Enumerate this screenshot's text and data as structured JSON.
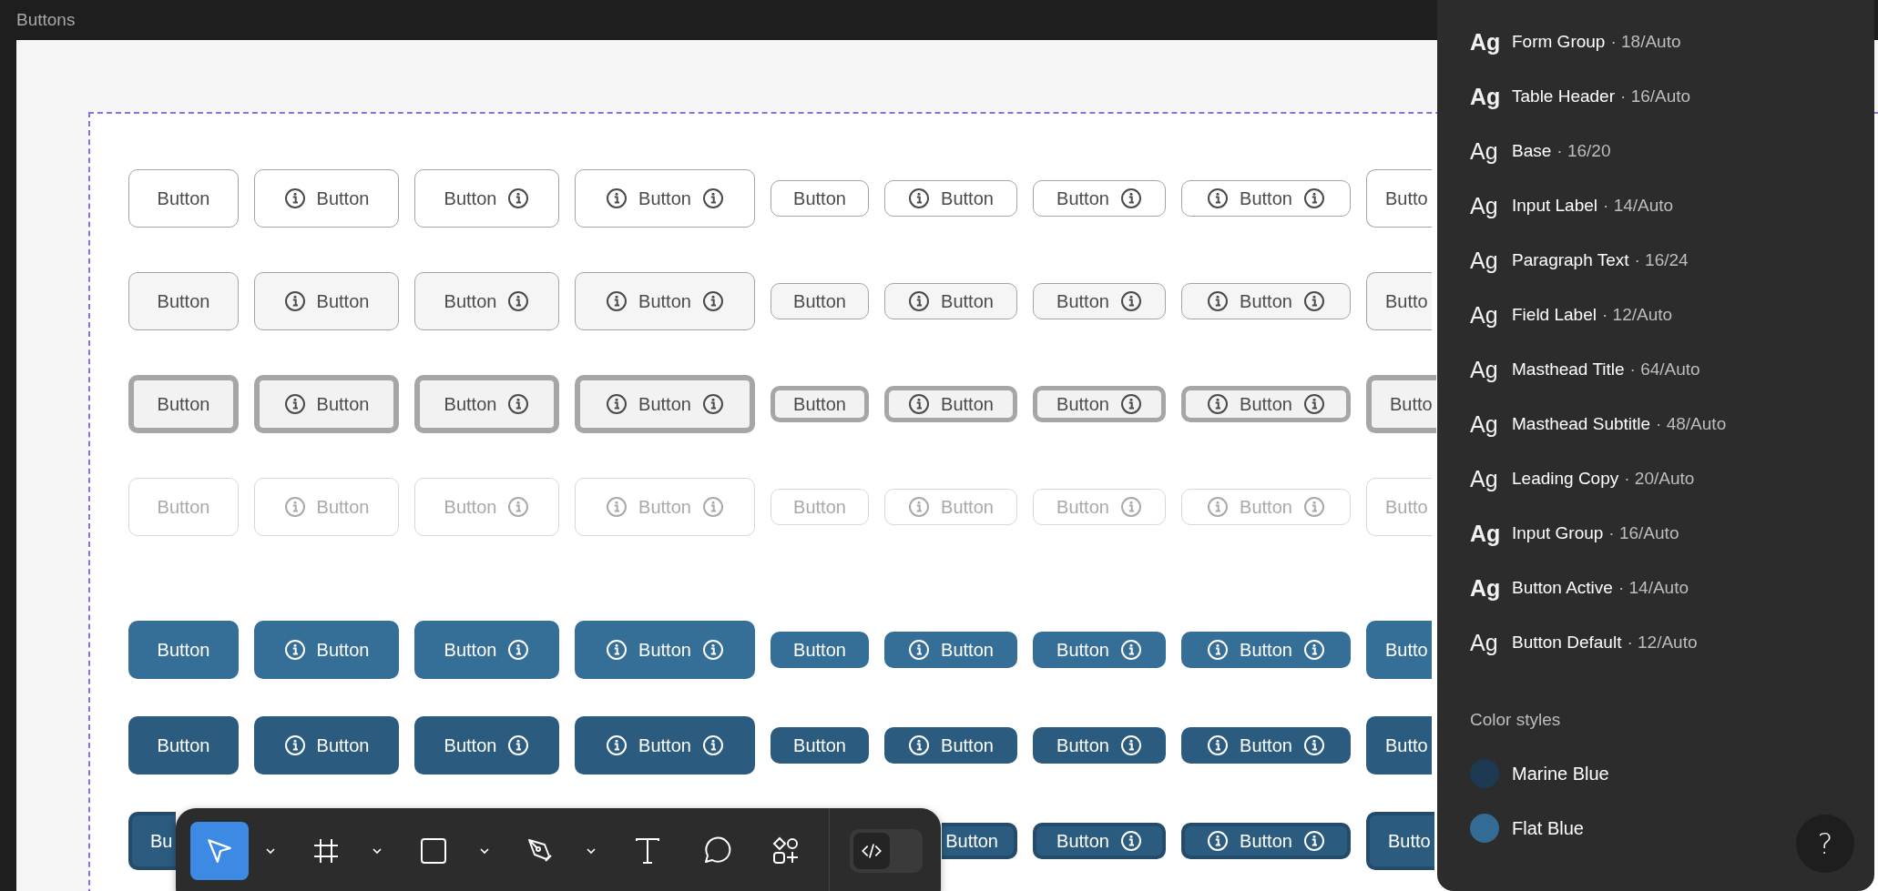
{
  "frame_title": "Buttons",
  "button_groups": [
    {
      "rows": [
        {
          "kind": "outline",
          "buttons": [
            {
              "kind": "large",
              "label": "Button",
              "icon_left": false,
              "icon_right": false
            },
            {
              "kind": "large",
              "label": "Button",
              "icon_left": true,
              "icon_right": false
            },
            {
              "kind": "large",
              "label": "Button",
              "icon_left": false,
              "icon_right": true
            },
            {
              "kind": "large",
              "label": "Button",
              "icon_left": true,
              "icon_right": true
            },
            {
              "kind": "small",
              "label": "Button",
              "icon_left": false,
              "icon_right": false
            },
            {
              "kind": "small",
              "label": "Button",
              "icon_left": true,
              "icon_right": false
            },
            {
              "kind": "small",
              "label": "Button",
              "icon_left": false,
              "icon_right": true
            },
            {
              "kind": "small",
              "label": "Button",
              "icon_left": true,
              "icon_right": true
            },
            {
              "kind": "cutend",
              "label": "Butto"
            }
          ]
        },
        {
          "kind": "soft",
          "buttons": [
            {
              "kind": "large",
              "label": "Button",
              "icon_left": false,
              "icon_right": false
            },
            {
              "kind": "large",
              "label": "Button",
              "icon_left": true,
              "icon_right": false
            },
            {
              "kind": "large",
              "label": "Button",
              "icon_left": false,
              "icon_right": true
            },
            {
              "kind": "large",
              "label": "Button",
              "icon_left": true,
              "icon_right": true
            },
            {
              "kind": "small",
              "label": "Button",
              "icon_left": false,
              "icon_right": false
            },
            {
              "kind": "small",
              "label": "Button",
              "icon_left": true,
              "icon_right": false
            },
            {
              "kind": "small",
              "label": "Button",
              "icon_left": false,
              "icon_right": true
            },
            {
              "kind": "small",
              "label": "Button",
              "icon_left": true,
              "icon_right": true
            },
            {
              "kind": "cutend",
              "label": "Butto"
            }
          ]
        },
        {
          "kind": "focused",
          "buttons": [
            {
              "kind": "large",
              "label": "Button",
              "icon_left": false,
              "icon_right": false
            },
            {
              "kind": "large",
              "label": "Button",
              "icon_left": true,
              "icon_right": false
            },
            {
              "kind": "large",
              "label": "Button",
              "icon_left": false,
              "icon_right": true
            },
            {
              "kind": "large",
              "label": "Button",
              "icon_left": true,
              "icon_right": true
            },
            {
              "kind": "small",
              "label": "Button",
              "icon_left": false,
              "icon_right": false
            },
            {
              "kind": "small",
              "label": "Button",
              "icon_left": true,
              "icon_right": false
            },
            {
              "kind": "small",
              "label": "Button",
              "icon_left": false,
              "icon_right": true
            },
            {
              "kind": "small",
              "label": "Button",
              "icon_left": true,
              "icon_right": true
            },
            {
              "kind": "cutend",
              "label": "Butto"
            }
          ]
        },
        {
          "kind": "disabled",
          "buttons": [
            {
              "kind": "large",
              "label": "Button",
              "icon_left": false,
              "icon_right": false
            },
            {
              "kind": "large",
              "label": "Button",
              "icon_left": true,
              "icon_right": false
            },
            {
              "kind": "large",
              "label": "Button",
              "icon_left": false,
              "icon_right": true
            },
            {
              "kind": "large",
              "label": "Button",
              "icon_left": true,
              "icon_right": true
            },
            {
              "kind": "small",
              "label": "Button",
              "icon_left": false,
              "icon_right": false
            },
            {
              "kind": "small",
              "label": "Button",
              "icon_left": true,
              "icon_right": false
            },
            {
              "kind": "small",
              "label": "Button",
              "icon_left": false,
              "icon_right": true
            },
            {
              "kind": "small",
              "label": "Button",
              "icon_left": true,
              "icon_right": true
            },
            {
              "kind": "cutend",
              "label": "Butto"
            }
          ]
        }
      ]
    },
    {
      "rows": [
        {
          "kind": "primary",
          "buttons": [
            {
              "kind": "large",
              "label": "Button",
              "icon_left": false,
              "icon_right": false
            },
            {
              "kind": "large",
              "label": "Button",
              "icon_left": true,
              "icon_right": false
            },
            {
              "kind": "large",
              "label": "Button",
              "icon_left": false,
              "icon_right": true
            },
            {
              "kind": "large",
              "label": "Button",
              "icon_left": true,
              "icon_right": true
            },
            {
              "kind": "small",
              "label": "Button",
              "icon_left": false,
              "icon_right": false
            },
            {
              "kind": "small",
              "label": "Button",
              "icon_left": true,
              "icon_right": false
            },
            {
              "kind": "small",
              "label": "Button",
              "icon_left": false,
              "icon_right": true
            },
            {
              "kind": "small",
              "label": "Button",
              "icon_left": true,
              "icon_right": true
            },
            {
              "kind": "cutend",
              "label": "Butto"
            }
          ]
        },
        {
          "kind": "dark",
          "buttons": [
            {
              "kind": "large",
              "label": "Button",
              "icon_left": false,
              "icon_right": false
            },
            {
              "kind": "large",
              "label": "Button",
              "icon_left": true,
              "icon_right": false
            },
            {
              "kind": "large",
              "label": "Button",
              "icon_left": false,
              "icon_right": true
            },
            {
              "kind": "large",
              "label": "Button",
              "icon_left": true,
              "icon_right": true
            },
            {
              "kind": "small",
              "label": "Button",
              "icon_left": false,
              "icon_right": false
            },
            {
              "kind": "small",
              "label": "Button",
              "icon_left": true,
              "icon_right": false
            },
            {
              "kind": "small",
              "label": "Button",
              "icon_left": false,
              "icon_right": true
            },
            {
              "kind": "small",
              "label": "Button",
              "icon_left": true,
              "icon_right": true
            },
            {
              "kind": "cutend",
              "label": "Butto"
            }
          ]
        },
        {
          "kind": "pressed",
          "buttons": [
            {
              "kind": "cutend",
              "label": "Bu"
            },
            {
              "kind": "hidden"
            },
            {
              "kind": "hidden"
            },
            {
              "kind": "hidden"
            },
            {
              "kind": "hidden"
            },
            {
              "kind": "cutstart",
              "label": "Button"
            },
            {
              "kind": "small",
              "label": "Button",
              "icon_left": false,
              "icon_right": true
            },
            {
              "kind": "small",
              "label": "Button",
              "icon_left": true,
              "icon_right": true
            },
            {
              "kind": "cutend",
              "label": "Butto"
            }
          ]
        }
      ]
    }
  ],
  "tools": [
    {
      "kind": "move",
      "selected": true,
      "has_menu": true
    },
    {
      "kind": "frame",
      "selected": false,
      "has_menu": true
    },
    {
      "kind": "rectangle",
      "selected": false,
      "has_menu": true
    },
    {
      "kind": "pen",
      "selected": false,
      "has_menu": true
    },
    {
      "kind": "text",
      "selected": false,
      "has_menu": false
    },
    {
      "kind": "comment",
      "selected": false,
      "has_menu": false
    },
    {
      "kind": "actions",
      "selected": false,
      "has_menu": false
    }
  ],
  "dev_mode": {
    "on": false
  },
  "text_styles": [
    {
      "sample": "Ag",
      "bold": true,
      "name": "Form Group",
      "spec": "· 18/Auto"
    },
    {
      "sample": "Ag",
      "bold": true,
      "name": "Table Header",
      "spec": "· 16/Auto"
    },
    {
      "sample": "Ag",
      "bold": false,
      "name": "Base",
      "spec": "· 16/20"
    },
    {
      "sample": "Ag",
      "bold": false,
      "name": "Input Label",
      "spec": "· 14/Auto"
    },
    {
      "sample": "Ag",
      "bold": false,
      "name": "Paragraph Text",
      "spec": "· 16/24"
    },
    {
      "sample": "Ag",
      "bold": false,
      "name": "Field Label",
      "spec": "· 12/Auto"
    },
    {
      "sample": "Ag",
      "bold": false,
      "name": "Masthead Title",
      "spec": "· 64/Auto"
    },
    {
      "sample": "Ag",
      "bold": false,
      "name": "Masthead Subtitle",
      "spec": "· 48/Auto"
    },
    {
      "sample": "Ag",
      "bold": false,
      "name": "Leading Copy",
      "spec": "· 20/Auto"
    },
    {
      "sample": "Ag",
      "bold": true,
      "name": "Input Group",
      "spec": "· 16/Auto"
    },
    {
      "sample": "Ag",
      "bold": true,
      "name": "Button Active",
      "spec": "· 14/Auto"
    },
    {
      "sample": "Ag",
      "bold": false,
      "name": "Button Default",
      "spec": "· 12/Auto"
    }
  ],
  "color_styles_heading": "Color styles",
  "color_styles": [
    {
      "name": "Marine Blue",
      "color": "#1e3a52"
    },
    {
      "name": "Flat Blue",
      "color": "#346b94"
    }
  ],
  "help_button": {
    "label": "?"
  }
}
